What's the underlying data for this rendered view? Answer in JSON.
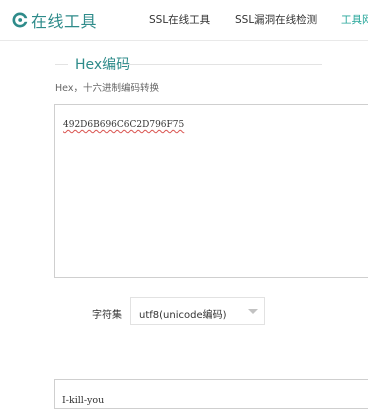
{
  "header": {
    "logo_text": "在线工具",
    "nav": [
      {
        "label": "SSL在线工具"
      },
      {
        "label": "SSL漏洞在线检测"
      },
      {
        "label": "工具网"
      }
    ]
  },
  "section": {
    "title": "Hex编码",
    "subtitle": "Hex，十六进制编码转换"
  },
  "input": {
    "value": "492D6B696C6C2D796F75"
  },
  "charset": {
    "label": "字符集",
    "selected": "utf8(unicode编码)"
  },
  "output": {
    "value": "I-kill-you"
  },
  "colors": {
    "brand": "#2e8b8a",
    "accent": "#26a69a",
    "border": "#cfcfcf"
  }
}
